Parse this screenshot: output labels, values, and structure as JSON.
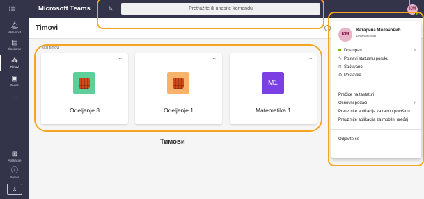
{
  "topbar": {
    "app_title": "Microsoft Teams",
    "search_placeholder": "Pretražite ili unesite komandu",
    "avatar_initials": "KM"
  },
  "rail": {
    "items": [
      {
        "label": "Aktivnost",
        "icon": "bell-icon"
      },
      {
        "label": "Ćaskanje",
        "icon": "chat-icon"
      },
      {
        "label": "Timovi",
        "icon": "teams-icon"
      },
      {
        "label": "Zadaci",
        "icon": "assignments-icon"
      },
      {
        "label": "...",
        "icon": "more-icon"
      },
      {
        "label": "Aplikacije",
        "icon": "apps-icon"
      },
      {
        "label": "Pomoć",
        "icon": "help-icon"
      }
    ]
  },
  "main": {
    "title": "Timovi",
    "section_label": "Vaši timovi",
    "cards": [
      {
        "name": "Odeljenje 3",
        "tile_color": "#5ecf9a",
        "initials": ""
      },
      {
        "name": "Odeljenje 1",
        "tile_color": "#f7b26b",
        "initials": ""
      },
      {
        "name": "Matematika 1",
        "tile_color": "#7b3fe4",
        "initials": "M1"
      }
    ],
    "more_label": "···",
    "caption": "Тимови"
  },
  "panel": {
    "initials": "KM",
    "name": "Катарина Милановић",
    "change_photo": "Promeni sliku",
    "status": "Dostupan",
    "set_status": "Postavi statusnu poruku",
    "saved": "Sačuvano",
    "settings": "Postavke",
    "shortcuts": "Prečice na tastaturi",
    "about": "Osnovni podaci",
    "download_desktop": "Preuzmite aplikacija za radnu površinu",
    "download_mobile": "Preuzmite aplikacija za mobilni uređaj",
    "sign_out": "Odjavite se"
  },
  "colors": {
    "rail_bg": "#33344a",
    "highlight": "#f4a522",
    "presence": "#6bb700"
  }
}
